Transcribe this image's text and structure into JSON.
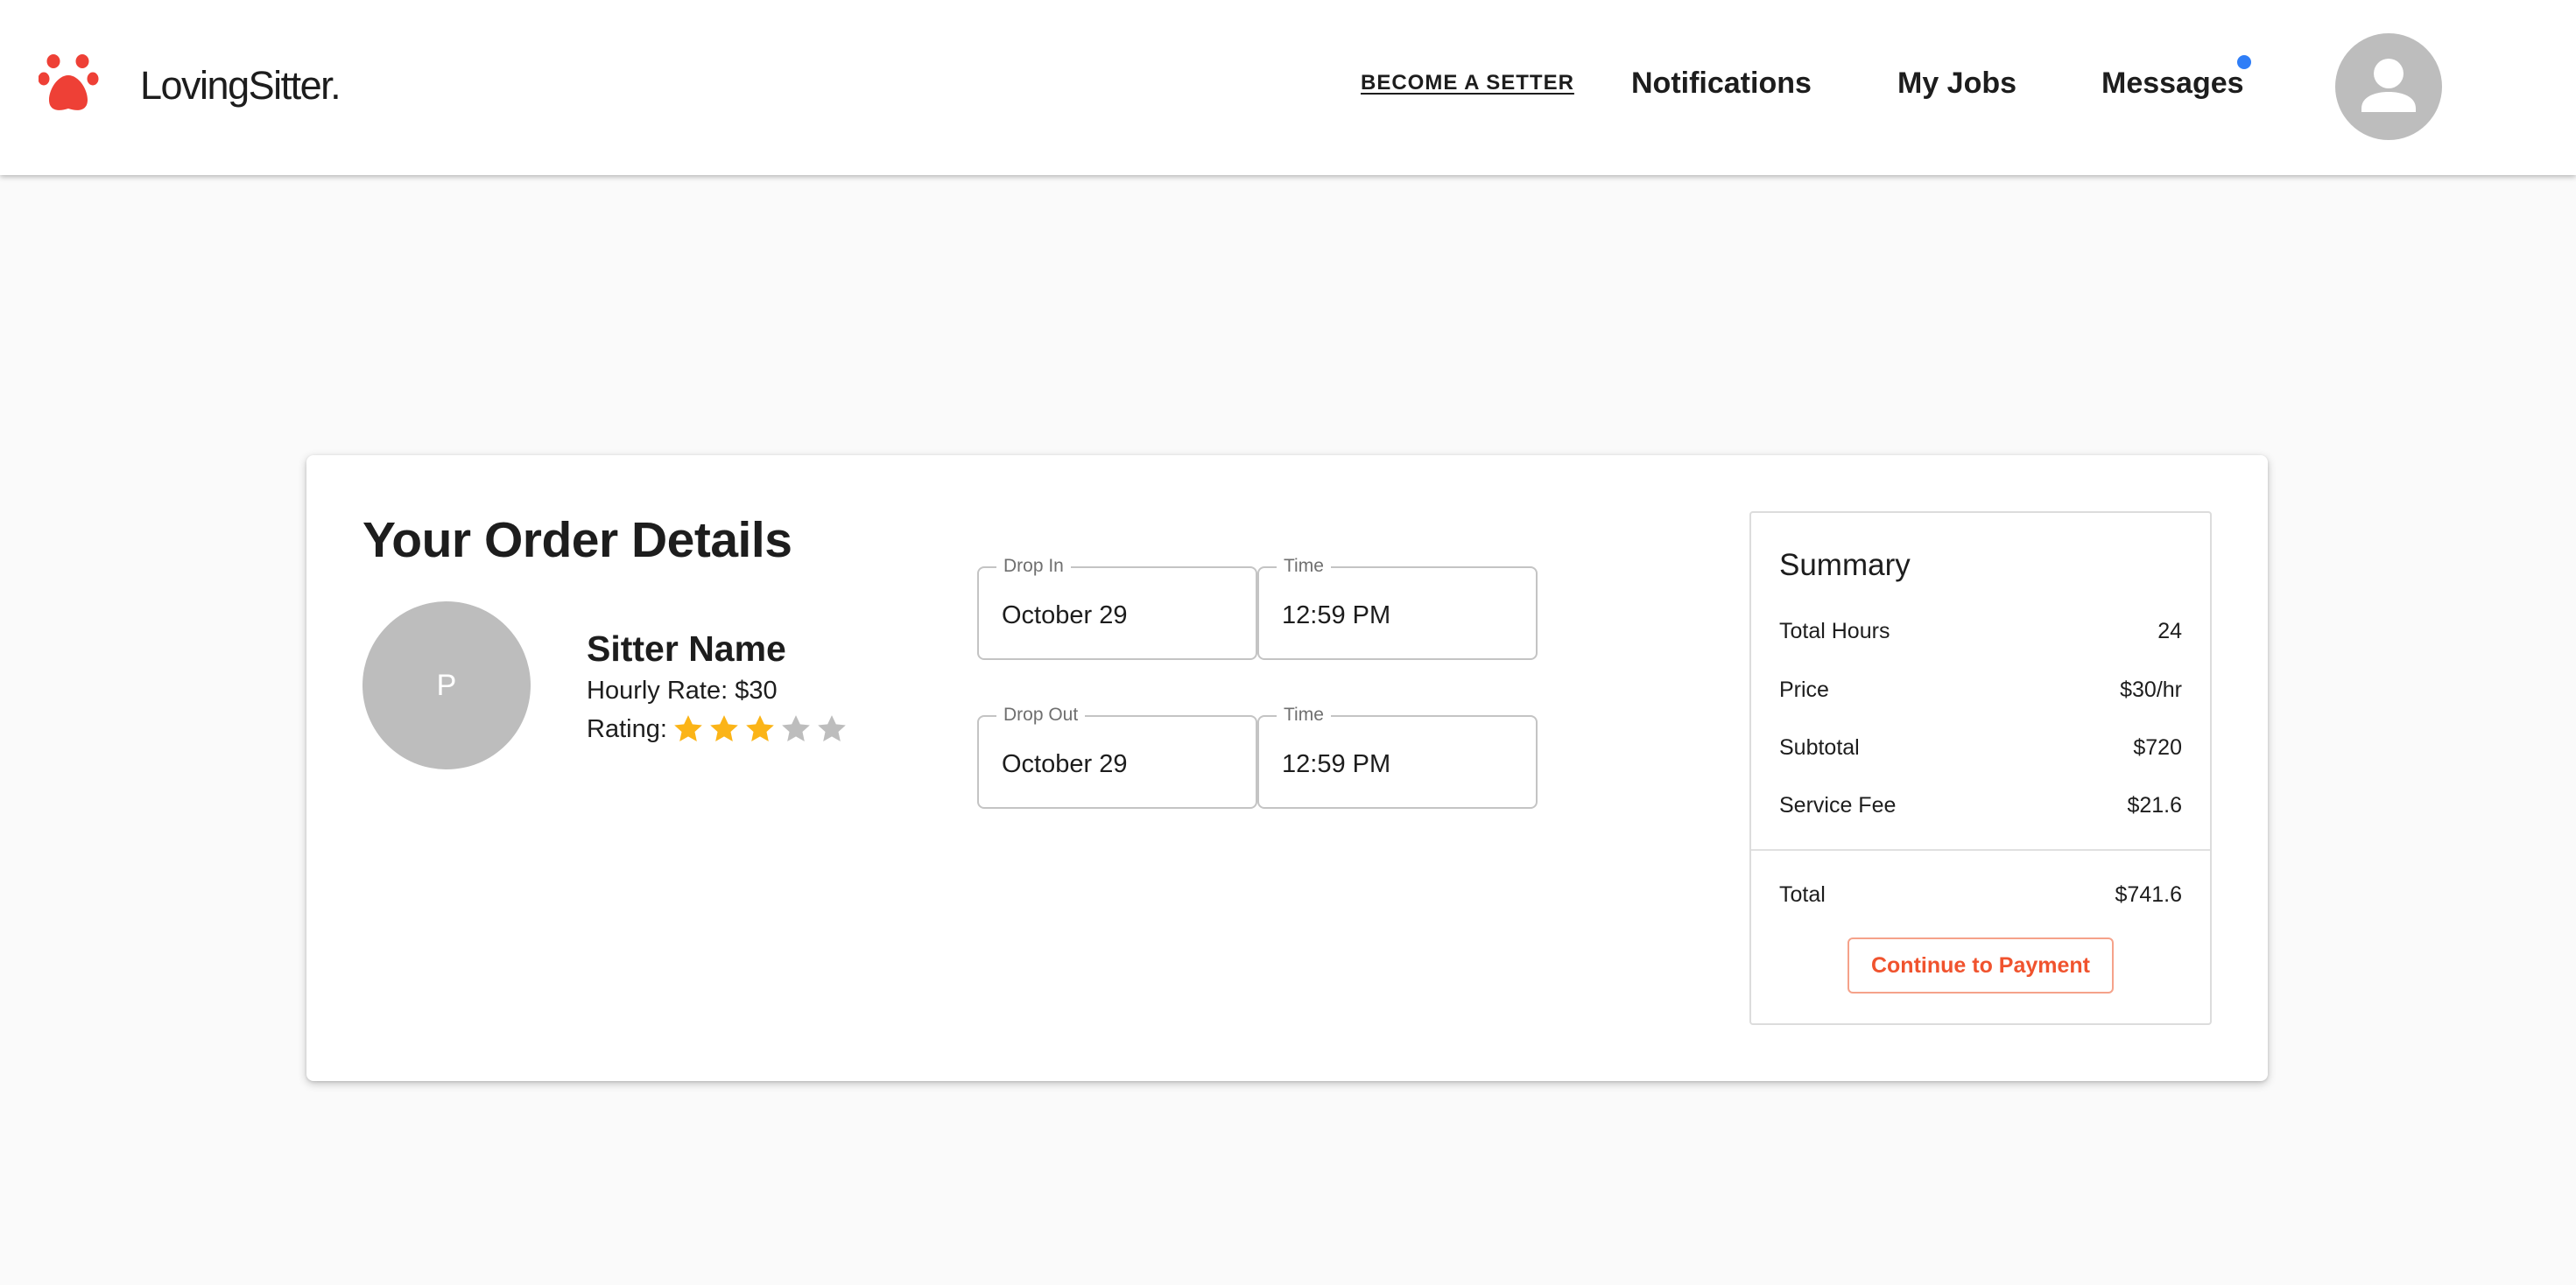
{
  "header": {
    "brand_name": "LovingSitter.",
    "logo_icon": "paw-icon",
    "become_sitter": "BECOME A SETTER",
    "notifications": "Notifications",
    "my_jobs": "My Jobs",
    "messages": "Messages",
    "messages_unread": true,
    "avatar_icon": "person-icon"
  },
  "order": {
    "title": "Your Order Details",
    "sitter": {
      "initial": "P",
      "name": "Sitter Name",
      "hourly_rate": "Hourly Rate: $30",
      "rating_label": "Rating:",
      "rating": 3,
      "rating_max": 5
    },
    "drop_in": {
      "date_label": "Drop In",
      "date_value": "October 29",
      "time_label": "Time",
      "time_value": "12:59 PM"
    },
    "drop_out": {
      "date_label": "Drop Out",
      "date_value": "October 29",
      "time_label": "Time",
      "time_value": "12:59 PM"
    }
  },
  "summary": {
    "title": "Summary",
    "rows": [
      {
        "label": "Total Hours",
        "value": "24"
      },
      {
        "label": "Price",
        "value": "$30/hr"
      },
      {
        "label": "Subtotal",
        "value": "$720"
      },
      {
        "label": "Service Fee",
        "value": "$21.6"
      }
    ],
    "total": {
      "label": "Total",
      "value": "$741.6"
    },
    "button": "Continue to Payment"
  },
  "colors": {
    "brand": "#ee4036",
    "accent": "#f0532e",
    "star_filled": "#fbb417",
    "star_empty": "#bdbdbd",
    "notification_dot": "#2f7ef7"
  }
}
